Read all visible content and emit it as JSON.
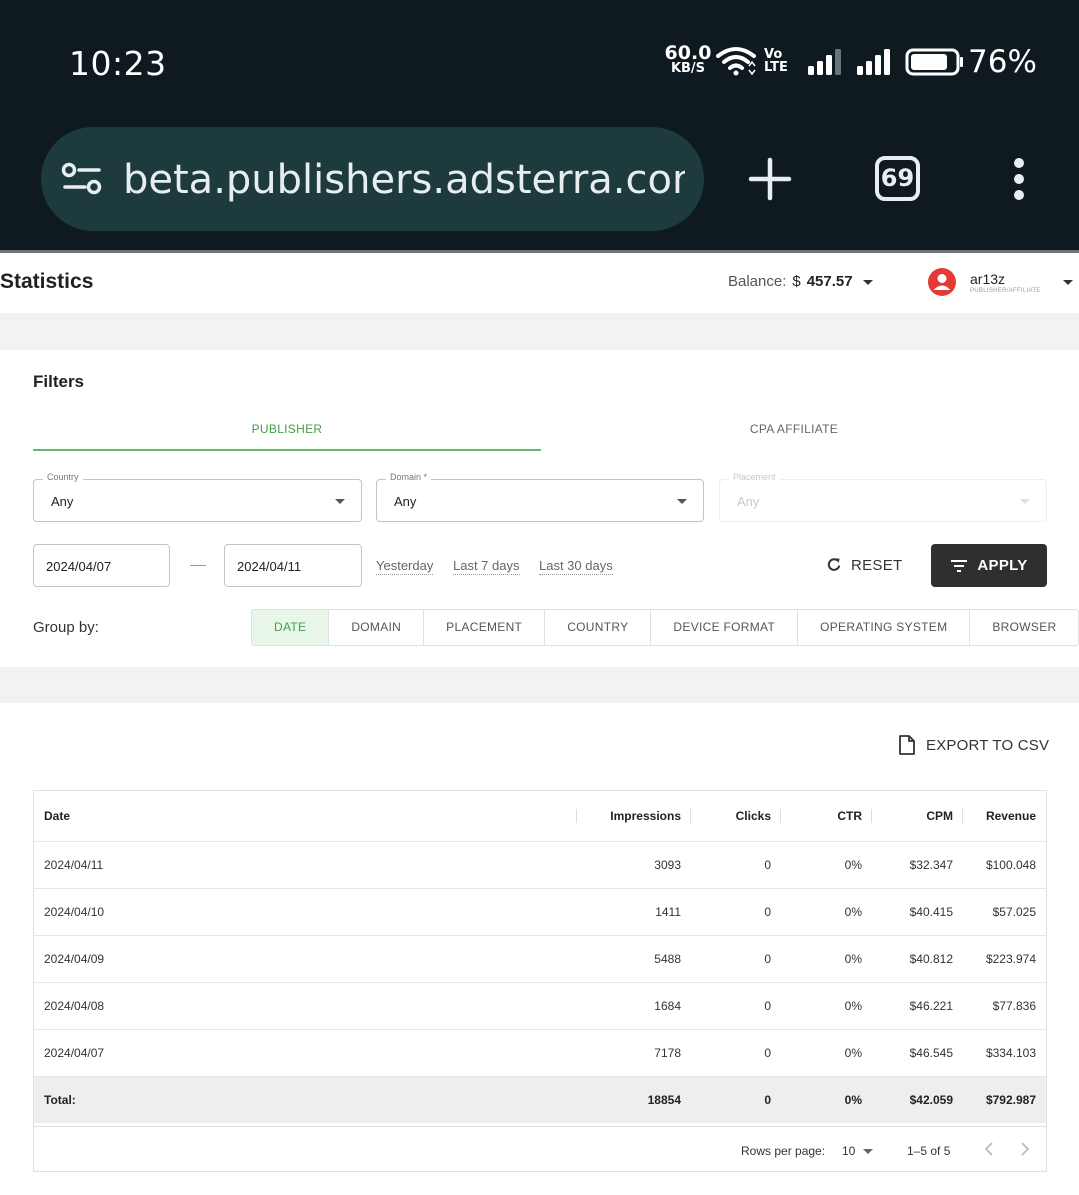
{
  "status_bar": {
    "time": "10:23",
    "net_speed_value": "60.0",
    "net_speed_unit": "KB/S",
    "volte_top": "Vo",
    "volte_bottom": "LTE",
    "battery_percent": "76%",
    "icons": [
      "wifi-icon",
      "signal-icon",
      "signal-icon",
      "battery-icon"
    ]
  },
  "browser": {
    "url": "beta.publishers.adsterra.com/s",
    "tab_count": "69",
    "icons": [
      "site-settings-icon",
      "new-tab-icon",
      "tab-switcher-icon",
      "menu-icon"
    ]
  },
  "header": {
    "title": "Statistics",
    "balance_label": "Balance:",
    "balance_currency": "$",
    "balance_value": "457.57",
    "username": "ar13z",
    "role": "PUBLISHER/AFFILIATE"
  },
  "filters": {
    "title": "Filters",
    "tabs": [
      {
        "label": "PUBLISHER",
        "active": true
      },
      {
        "label": "CPA AFFILIATE",
        "active": false
      }
    ],
    "country": {
      "label": "Country",
      "value": "Any"
    },
    "domain": {
      "label": "Domain *",
      "value": "Any"
    },
    "placement": {
      "label": "Placement",
      "value": "Any",
      "disabled": true
    },
    "date_from": "2024/04/07",
    "date_to": "2024/04/11",
    "quick_ranges": [
      "Yesterday",
      "Last 7 days",
      "Last 30 days"
    ],
    "reset_label": "RESET",
    "apply_label": "APPLY",
    "group_by_label": "Group by:",
    "group_by_options": [
      "DATE",
      "DOMAIN",
      "PLACEMENT",
      "COUNTRY",
      "DEVICE FORMAT",
      "OPERATING SYSTEM",
      "BROWSER"
    ],
    "group_by_selected": "DATE"
  },
  "table": {
    "export_label": "EXPORT TO CSV",
    "columns": [
      "Date",
      "Impressions",
      "Clicks",
      "CTR",
      "CPM",
      "Revenue"
    ],
    "rows": [
      [
        "2024/04/11",
        "3093",
        "0",
        "0%",
        "$32.347",
        "$100.048"
      ],
      [
        "2024/04/10",
        "1411",
        "0",
        "0%",
        "$40.415",
        "$57.025"
      ],
      [
        "2024/04/09",
        "5488",
        "0",
        "0%",
        "$40.812",
        "$223.974"
      ],
      [
        "2024/04/08",
        "1684",
        "0",
        "0%",
        "$46.221",
        "$77.836"
      ],
      [
        "2024/04/07",
        "7178",
        "0",
        "0%",
        "$46.545",
        "$334.103"
      ]
    ],
    "total": [
      "Total:",
      "18854",
      "0",
      "0%",
      "$42.059",
      "$792.987"
    ],
    "pagination": {
      "rows_per_page_label": "Rows per page:",
      "rows_per_page": "10",
      "range": "1–5 of 5"
    }
  },
  "colors": {
    "status_bg": "#0e1a1f",
    "url_pill": "#1d3a3d",
    "accent_green": "#43a047",
    "apply_bg": "#2f2f2f",
    "avatar_red": "#e53935"
  }
}
